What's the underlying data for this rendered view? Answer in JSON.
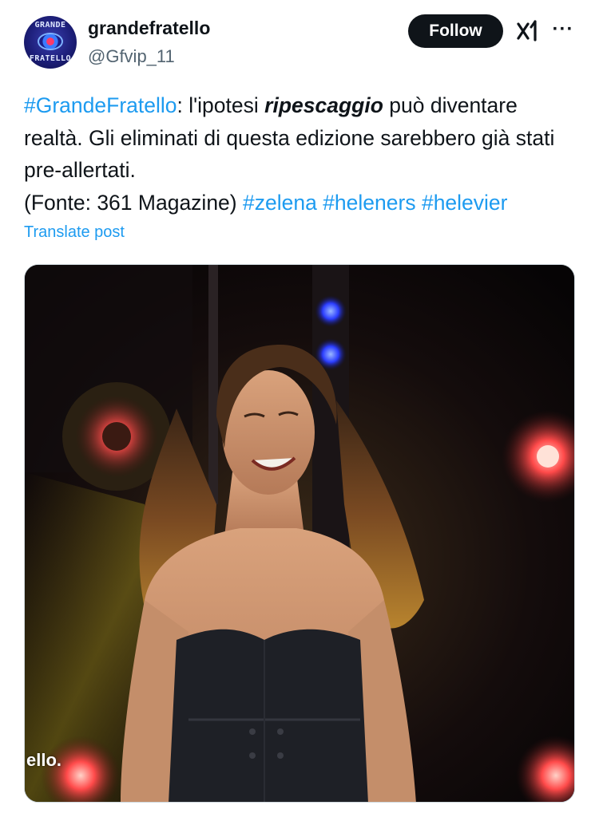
{
  "account": {
    "avatar_text_top": "GRANDE",
    "avatar_text_bottom": "FRATELLO",
    "name": "grandefratello",
    "handle": "@Gfvip_11"
  },
  "actions": {
    "follow_label": "Follow",
    "grok_icon": "grok-icon",
    "more_icon": "more-icon",
    "more_glyph": "···"
  },
  "post": {
    "hashtag_main": "#GrandeFratello",
    "text_1": ": l'ipotesi ",
    "text_emph": "ripescaggio",
    "text_2": " può diventare realtà. Gli eliminati di questa edizione sarebbero già stati pre-allertati.",
    "text_source": "(Fonte: 361 Magazine) ",
    "hashtag_1": "#zelena",
    "hashtag_2": "#heleners",
    "hashtag_3": "#helevier",
    "translate_label": "Translate post"
  },
  "media": {
    "watermark_text": "ello."
  },
  "colors": {
    "link": "#1d9bf0",
    "text": "#0f1419",
    "secondary": "#536471",
    "follow_bg": "#0f1419"
  }
}
